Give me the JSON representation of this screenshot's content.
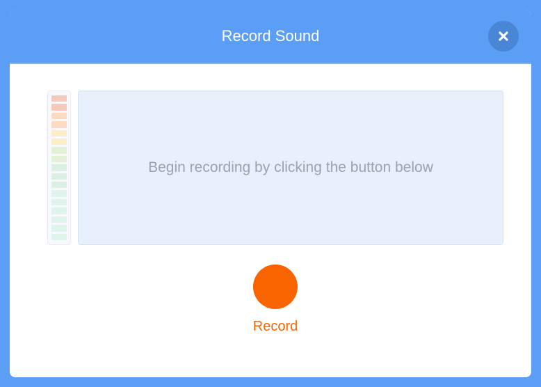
{
  "modal": {
    "title": "Record Sound",
    "hint": "Begin recording by clicking the button below",
    "record_label": "Record"
  }
}
